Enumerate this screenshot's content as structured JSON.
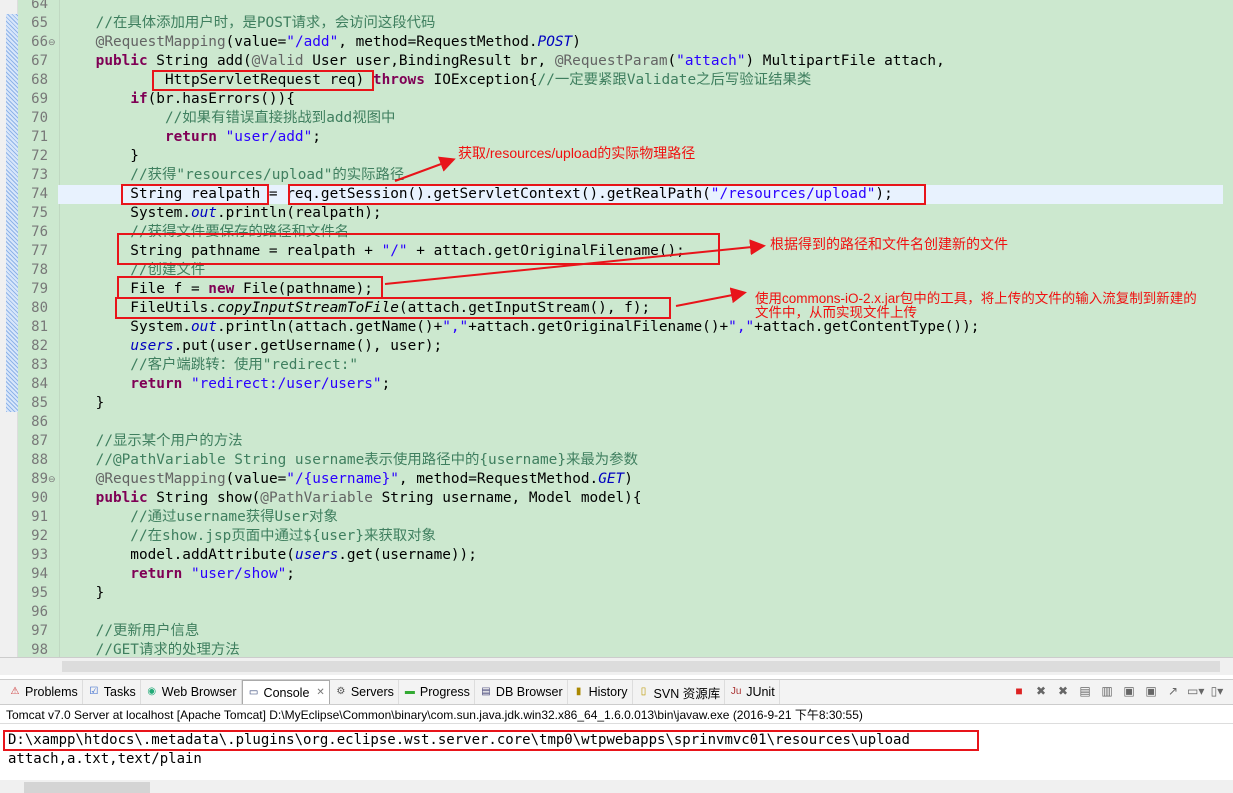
{
  "editor": {
    "first_line": 64,
    "current_line": 74,
    "lines": [
      [],
      [
        [
          "cm",
          "    //在具体添加用户时，是POST请求，会访问这段代码"
        ]
      ],
      [
        [
          "p",
          "    "
        ],
        [
          "ann",
          "@RequestMapping"
        ],
        [
          "p",
          "(value="
        ],
        [
          "str",
          "\"/add\""
        ],
        [
          "p",
          ", method=RequestMethod."
        ],
        [
          "itb",
          "POST"
        ],
        [
          "p",
          ")"
        ]
      ],
      [
        [
          "p",
          "    "
        ],
        [
          "kw",
          "public"
        ],
        [
          "p",
          " String add("
        ],
        [
          "ann",
          "@Valid"
        ],
        [
          "p",
          " User user,BindingResult br, "
        ],
        [
          "ann",
          "@RequestParam"
        ],
        [
          "p",
          "("
        ],
        [
          "str",
          "\"attach\""
        ],
        [
          "p",
          ") MultipartFile attach,"
        ]
      ],
      [
        [
          "p",
          "            HttpServletRequest req) "
        ],
        [
          "kw",
          "throws"
        ],
        [
          "p",
          " IOException{"
        ],
        [
          "cm",
          "//一定要紧跟Validate之后写验证结果类"
        ]
      ],
      [
        [
          "p",
          "        "
        ],
        [
          "kw",
          "if"
        ],
        [
          "p",
          "(br.hasErrors()){"
        ]
      ],
      [
        [
          "cm",
          "            //如果有错误直接挑战到add视图中"
        ]
      ],
      [
        [
          "p",
          "            "
        ],
        [
          "kw",
          "return"
        ],
        [
          "p",
          " "
        ],
        [
          "str",
          "\"user/add\""
        ],
        [
          "p",
          ";"
        ]
      ],
      [
        [
          "p",
          "        }"
        ]
      ],
      [
        [
          "cm",
          "        //获得\"resources/upload\"的实际路径"
        ]
      ],
      [
        [
          "p",
          "        String realpath = req.getSession().getServletContext().getRealPath("
        ],
        [
          "str",
          "\"/resources/upload\""
        ],
        [
          "p",
          ");"
        ]
      ],
      [
        [
          "p",
          "        System."
        ],
        [
          "fld",
          "out"
        ],
        [
          "p",
          ".println(realpath);"
        ]
      ],
      [
        [
          "cm",
          "        //获得文件要保存的路径和文件名"
        ]
      ],
      [
        [
          "p",
          "        String pathname = realpath + "
        ],
        [
          "str",
          "\"/\""
        ],
        [
          "p",
          " + attach.getOriginalFilename();"
        ]
      ],
      [
        [
          "cm",
          "        //创建文件"
        ]
      ],
      [
        [
          "p",
          "        File f = "
        ],
        [
          "kw",
          "new"
        ],
        [
          "p",
          " File(pathname);"
        ]
      ],
      [
        [
          "p",
          "        FileUtils."
        ],
        [
          "it",
          "copyInputStreamToFile"
        ],
        [
          "p",
          "(attach.getInputStream(), f);"
        ]
      ],
      [
        [
          "p",
          "        System."
        ],
        [
          "fld",
          "out"
        ],
        [
          "p",
          ".println(attach.getName()+"
        ],
        [
          "str",
          "\",\""
        ],
        [
          "p",
          "+attach.getOriginalFilename()+"
        ],
        [
          "str",
          "\",\""
        ],
        [
          "p",
          "+attach.getContentType());"
        ]
      ],
      [
        [
          "p",
          "        "
        ],
        [
          "fld",
          "users"
        ],
        [
          "p",
          ".put(user.getUsername(), user);"
        ]
      ],
      [
        [
          "cm",
          "        //客户端跳转：使用\"redirect:\""
        ]
      ],
      [
        [
          "p",
          "        "
        ],
        [
          "kw",
          "return"
        ],
        [
          "p",
          " "
        ],
        [
          "str",
          "\"redirect:/user/users\""
        ],
        [
          "p",
          ";"
        ]
      ],
      [
        [
          "p",
          "    }"
        ]
      ],
      [],
      [
        [
          "cm",
          "    //显示某个用户的方法"
        ]
      ],
      [
        [
          "cm",
          "    //@PathVariable String username表示使用路径中的{username}来最为参数"
        ]
      ],
      [
        [
          "p",
          "    "
        ],
        [
          "ann",
          "@RequestMapping"
        ],
        [
          "p",
          "(value="
        ],
        [
          "str",
          "\"/{username}\""
        ],
        [
          "p",
          ", method=RequestMethod."
        ],
        [
          "itb",
          "GET"
        ],
        [
          "p",
          ")"
        ]
      ],
      [
        [
          "p",
          "    "
        ],
        [
          "kw",
          "public"
        ],
        [
          "p",
          " String show("
        ],
        [
          "ann",
          "@PathVariable"
        ],
        [
          "p",
          " String username, Model model){"
        ]
      ],
      [
        [
          "cm",
          "        //通过username获得User对象"
        ]
      ],
      [
        [
          "cm",
          "        //在show.jsp页面中通过${user}来获取对象"
        ]
      ],
      [
        [
          "p",
          "        model.addAttribute("
        ],
        [
          "fld",
          "users"
        ],
        [
          "p",
          ".get(username));"
        ]
      ],
      [
        [
          "p",
          "        "
        ],
        [
          "kw",
          "return"
        ],
        [
          "p",
          " "
        ],
        [
          "str",
          "\"user/show\""
        ],
        [
          "p",
          ";"
        ]
      ],
      [
        [
          "p",
          "    }"
        ]
      ],
      [],
      [
        [
          "cm",
          "    //更新用户信息"
        ]
      ],
      [
        [
          "cm",
          "    //GET请求的处理方法"
        ]
      ]
    ]
  },
  "annotations": {
    "realpath_note": "获取/resources/upload的实际物理路径",
    "file_note": "根据得到的路径和文件名创建新的文件",
    "copy_note": "使用commons-iO-2.x.jar包中的工具，将上传的文件的输入流复制到新建的文件中，从而实现文件上传",
    "color": "#e8141a"
  },
  "views": {
    "tabs": [
      {
        "label": "Problems",
        "icon": "problems-icon"
      },
      {
        "label": "Tasks",
        "icon": "tasks-icon"
      },
      {
        "label": "Web Browser",
        "icon": "globe-icon"
      },
      {
        "label": "Console",
        "icon": "console-icon",
        "active": true,
        "close": "✕"
      },
      {
        "label": "Servers",
        "icon": "servers-icon"
      },
      {
        "label": "Progress",
        "icon": "progress-icon"
      },
      {
        "label": "DB Browser",
        "icon": "database-icon"
      },
      {
        "label": "History",
        "icon": "history-icon"
      },
      {
        "label": "SVN 资源库",
        "icon": "svn-icon"
      },
      {
        "label": "JUnit",
        "icon": "junit-icon"
      }
    ]
  },
  "console": {
    "header": "Tomcat v7.0 Server at localhost [Apache Tomcat] D:\\MyEclipse\\Common\\binary\\com.sun.java.jdk.win32.x86_64_1.6.0.013\\bin\\javaw.exe (2016-9-21 下午8:30:55)",
    "lines": [
      "D:\\xampp\\htdocs\\.metadata\\.plugins\\org.eclipse.wst.server.core\\tmp0\\wtpwebapps\\sprinvmvc01\\resources\\upload",
      "attach,a.txt,text/plain"
    ]
  }
}
